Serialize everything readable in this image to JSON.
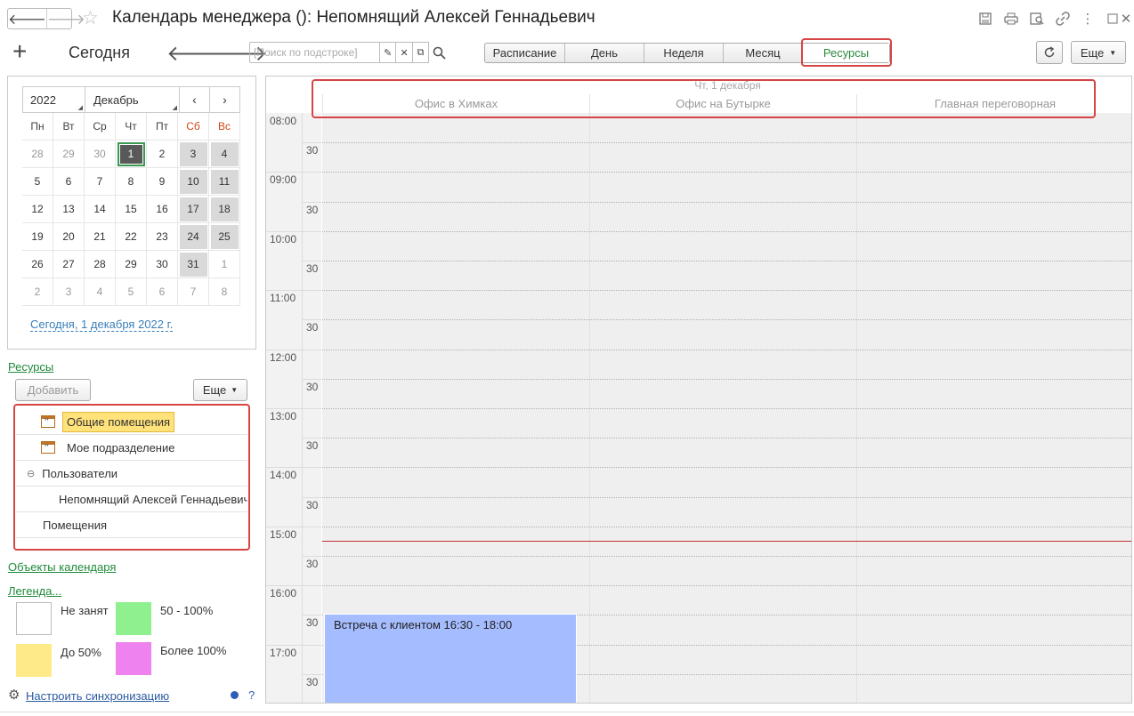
{
  "window": {
    "title": "Календарь менеджера (): Непомнящий Алексей Геннадьевич",
    "icons": [
      "save-icon",
      "print-icon",
      "preview-icon",
      "link-icon",
      "more-vert-icon",
      "maximize-icon",
      "close-icon"
    ]
  },
  "toolbar": {
    "today_label": "Сегодня",
    "search_placeholder": "[Поиск по подстроке]",
    "views": [
      "Расписание",
      "День",
      "Неделя",
      "Месяц",
      "Ресурсы"
    ],
    "active_view": "Ресурсы",
    "more_label": "Еще"
  },
  "calendar": {
    "year": "2022",
    "month": "Декабрь",
    "weekdays": [
      "Пн",
      "Вт",
      "Ср",
      "Чт",
      "Пт",
      "Сб",
      "Вс"
    ],
    "weeks": [
      [
        "28",
        "29",
        "30",
        "1",
        "2",
        "3",
        "4"
      ],
      [
        "5",
        "6",
        "7",
        "8",
        "9",
        "10",
        "11"
      ],
      [
        "12",
        "13",
        "14",
        "15",
        "16",
        "17",
        "18"
      ],
      [
        "19",
        "20",
        "21",
        "22",
        "23",
        "24",
        "25"
      ],
      [
        "26",
        "27",
        "28",
        "29",
        "30",
        "31",
        "1"
      ],
      [
        "2",
        "3",
        "4",
        "5",
        "6",
        "7",
        "8"
      ]
    ],
    "selected_day": "1",
    "today_link": "Сегодня, 1 декабря 2022 г."
  },
  "resources": {
    "title": "Ресурсы",
    "add_label": "Добавить",
    "more_label": "Еще",
    "items": [
      {
        "label": "Общие помещения",
        "icon": "resource-group-icon",
        "highlighted": true
      },
      {
        "label": "Мое подразделение",
        "icon": "resource-group-icon"
      },
      {
        "label": "Пользователи",
        "icon": "collapse-icon"
      },
      {
        "label": "Непомнящий Алексей Геннадьевич"
      },
      {
        "label": "Помещения"
      }
    ]
  },
  "calendar_objects_link": "Объекты календаря",
  "legend": {
    "title": "Легенда...",
    "items": [
      {
        "label": "Не занят",
        "color": "#ffffff"
      },
      {
        "label": "50 - 100%",
        "color": "#8ef08e"
      },
      {
        "label": "До 50%",
        "color": "#ffea8a"
      },
      {
        "label": "Более 100%",
        "color": "#ee82ee"
      }
    ]
  },
  "sync": {
    "label": "Настроить синхронизацию",
    "help": "?"
  },
  "schedule": {
    "date_header": "Чт, 1 декабря",
    "columns": [
      "Офис в Химках",
      "Офис на Бутырке",
      "Главная переговорная"
    ],
    "hours": [
      "08:00",
      "09:00",
      "10:00",
      "11:00",
      "12:00",
      "13:00",
      "14:00",
      "15:00",
      "16:00",
      "17:00"
    ],
    "half_label": "30",
    "events": [
      {
        "title": "Встреча с клиентом 16:30 - 18:00",
        "column": 0,
        "start": "16:30",
        "end": "18:00",
        "color": "#a5bcff"
      }
    ],
    "now_time": "15:15"
  }
}
